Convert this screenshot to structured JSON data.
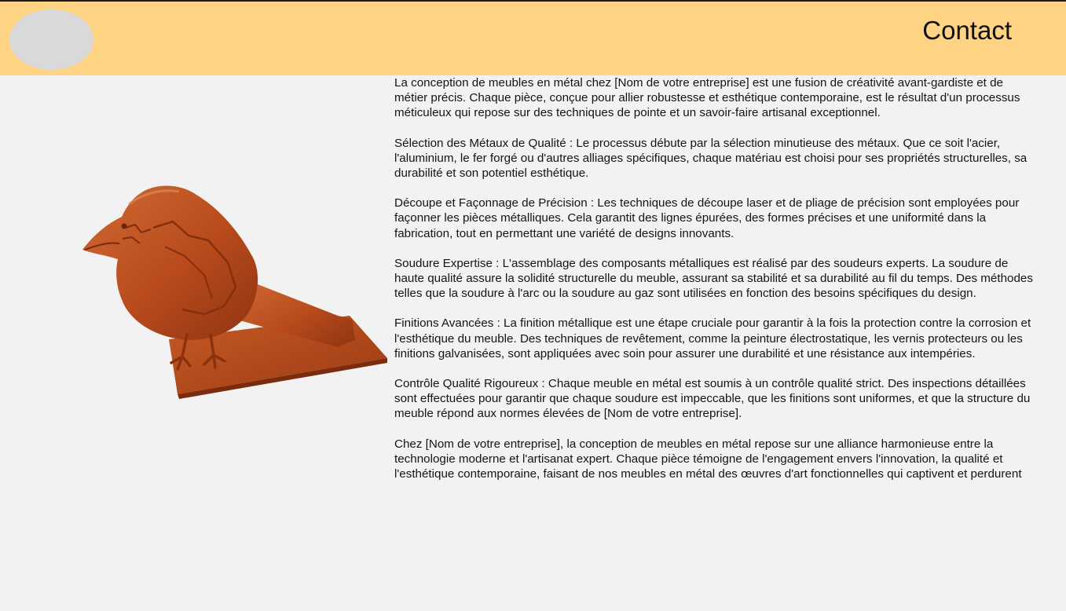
{
  "header": {
    "nav_contact": "Contact",
    "logo_icon": "logo-placeholder-icon"
  },
  "hero": {
    "image_icon": "metal-bird-sculpture-icon",
    "image_color": "#b84a1c"
  },
  "article": {
    "paragraphs": [
      "La conception de meubles en métal chez [Nom de votre entreprise] est une fusion de créativité avant-gardiste et de métier précis. Chaque pièce, conçue pour allier robustesse et esthétique contemporaine, est le résultat d'un processus méticuleux qui repose sur des techniques de pointe et un savoir-faire artisanal exceptionnel.",
      "Sélection des Métaux de Qualité : Le processus débute par la sélection minutieuse des métaux. Que ce soit l'acier, l'aluminium, le fer forgé ou d'autres alliages spécifiques, chaque matériau est choisi pour ses propriétés structurelles, sa durabilité et son potentiel esthétique.",
      "Découpe et Façonnage de Précision : Les techniques de découpe laser et de pliage de précision sont employées pour façonner les pièces métalliques. Cela garantit des lignes épurées, des formes précises et une uniformité dans la fabrication, tout en permettant une variété de designs innovants.",
      "Soudure Expertise : L'assemblage des composants métalliques est réalisé par des soudeurs experts. La soudure de haute qualité assure la solidité structurelle du meuble, assurant sa stabilité et sa durabilité au fil du temps. Des méthodes telles que la soudure à l'arc ou la soudure au gaz sont utilisées en fonction des besoins spécifiques du design.",
      "Finitions Avancées : La finition métallique est une étape cruciale pour garantir à la fois la protection contre la corrosion et l'esthétique du meuble. Des techniques de revêtement, comme la peinture électrostatique, les vernis protecteurs ou les finitions galvanisées, sont appliquées avec soin pour assurer une durabilité et une résistance aux intempéries.",
      "Contrôle Qualité Rigoureux : Chaque meuble en métal est soumis à un contrôle qualité strict. Des inspections détaillées sont effectuées pour garantir que chaque soudure est impeccable, que les finitions sont uniformes, et que la structure du meuble répond aux normes élevées de [Nom de votre entreprise].",
      "Chez [Nom de votre entreprise], la conception de meubles en métal repose sur une alliance harmonieuse entre la technologie moderne et l'artisanat expert. Chaque pièce témoigne de l'engagement envers l'innovation, la qualité et l'esthétique contemporaine, faisant de nos meubles en métal des œuvres d'art fonctionnelles qui captivent et perdurent"
    ]
  },
  "colors": {
    "header_background": "#ffd384",
    "page_background": "#f2f2f2",
    "logo_placeholder": "#d9d9d9",
    "text": "#141414"
  }
}
